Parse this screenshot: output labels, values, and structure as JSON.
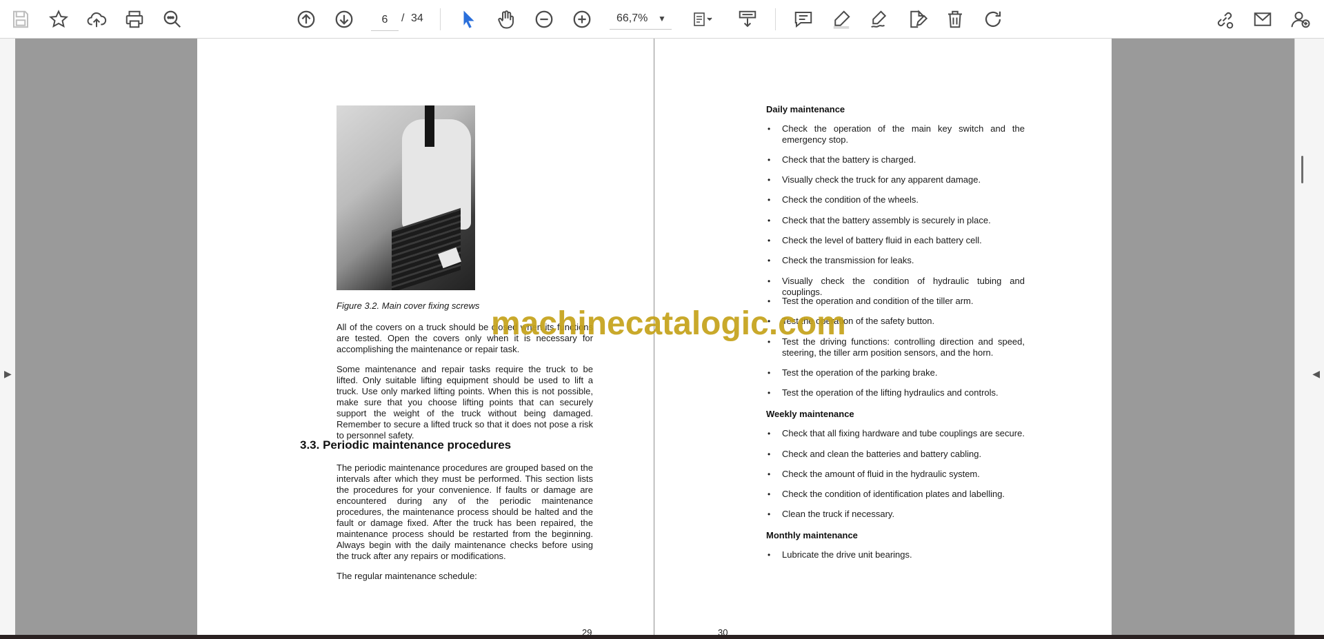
{
  "toolbar": {
    "icons": [
      "save-icon",
      "bookmark-star-icon",
      "upload-cloud-icon",
      "print-icon",
      "zoom-search-icon",
      "page-up-icon",
      "page-down-icon",
      "select-arrow-icon",
      "hand-pan-icon",
      "zoom-out-icon",
      "zoom-in-icon",
      "fit-page-icon",
      "scroll-mode-icon",
      "comment-icon",
      "highlight-pen-icon",
      "draw-signature-icon",
      "edit-doc-icon",
      "delete-trash-icon",
      "rotate-icon",
      "share-link-icon",
      "email-icon",
      "add-user-icon"
    ],
    "current_page": "6",
    "page_separator": "/",
    "total_pages": "34",
    "zoom": "66,7%"
  },
  "left_page": {
    "figure_caption": "Figure 3.2. Main cover fixing screws",
    "para1": "All of the covers on a truck should be closed when its functions are tested. Open the covers only when it is necessary for accomplishing the maintenance or repair task.",
    "para2": "Some maintenance and repair tasks require the truck to be lifted. Only suitable lifting equipment should be used to lift a truck. Use only marked lifting points. When this is not possible, make sure that you choose lifting points that can securely support the weight of the truck without being damaged. Remember to secure a lifted truck so that it does not pose a risk to personnel safety.",
    "section_heading": "3.3. Periodic maintenance procedures",
    "para3": "The periodic maintenance procedures are grouped based on the intervals after which they must be performed. This section lists the procedures for your convenience. If faults or damage are encountered during any of the periodic maintenance procedures, the maintenance process should be halted and the fault or damage fixed. After the truck has been repaired, the maintenance process should be restarted from the beginning. Always begin with the daily maintenance checks before using the truck after any repairs or modifications.",
    "para4": "The regular maintenance schedule:",
    "page_number": "29"
  },
  "right_page": {
    "daily_heading": "Daily maintenance",
    "daily_items": [
      "Check the operation of the main key switch and the emergency stop.",
      "Check that the battery is charged.",
      "Visually check the truck for any apparent damage.",
      "Check the condition of the wheels.",
      "Check that the battery assembly is securely in place.",
      "Check the level of battery fluid in each battery cell.",
      "Check the transmission for leaks.",
      "Visually check the condition of hydraulic tubing and couplings.",
      "Test the operation and condition of the tiller arm.",
      "Test the operation of the safety button.",
      "Test the driving functions: controlling direction and speed, steering, the tiller arm position sensors, and the horn.",
      "Test the operation of the parking brake.",
      "Test the operation of the lifting hydraulics and controls."
    ],
    "weekly_heading": "Weekly maintenance",
    "weekly_items": [
      "Check that all fixing hardware and tube couplings are secure.",
      "Check and clean the batteries and battery cabling.",
      "Check the amount of fluid in the hydraulic system.",
      "Check the condition of identification plates and labelling.",
      "Clean the truck if necessary."
    ],
    "monthly_heading": "Monthly maintenance",
    "monthly_items": [
      "Lubricate the drive unit bearings."
    ],
    "bullet": "•",
    "page_number": "30"
  },
  "watermark": "machinecatalogic.com",
  "rail": {
    "left_arrow": "▶",
    "right_arrow": "◀"
  },
  "zoom_chevron": "▼"
}
